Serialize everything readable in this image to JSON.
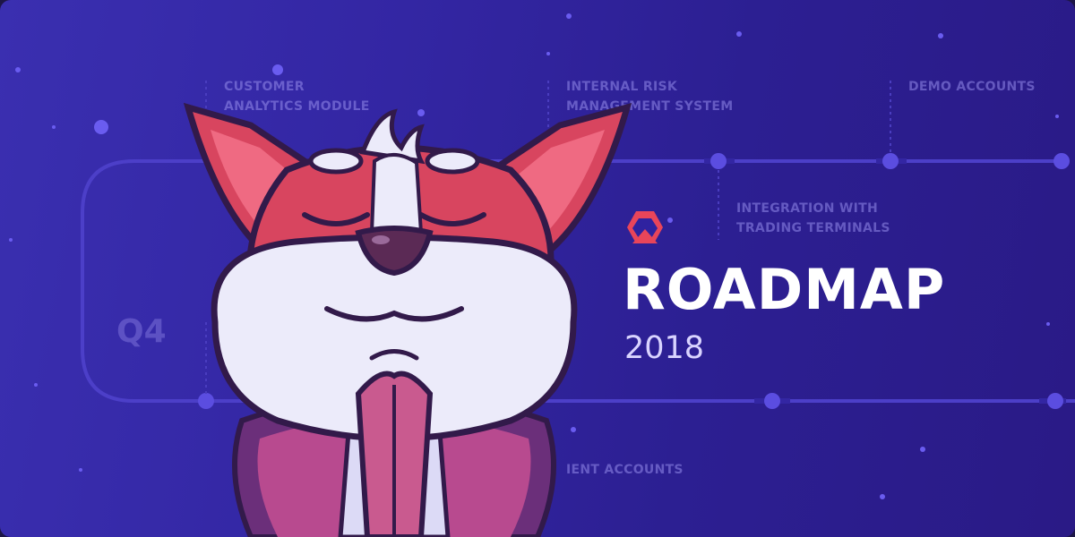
{
  "title": "ROADMAP",
  "year": "2018",
  "quarter_label": "Q4",
  "milestones": [
    {
      "label": "CUSTOMER\nANALYTICS MODULE"
    },
    {
      "label": "INTERNAL RISK\nMANAGEMENT SYSTEM"
    },
    {
      "label": "DEMO ACCOUNTS"
    },
    {
      "label": "INTEGRATION WITH\nTRADING TERMINALS"
    },
    {
      "label": "IENT ACCOUNTS"
    }
  ],
  "colors": {
    "background": "#3326a3",
    "timeline": "#5a4ad8",
    "logo": "#e8455a",
    "title": "#ffffff",
    "mascot_red": "#d8455f"
  },
  "icons": {
    "logo": "hexagon-logo-icon",
    "mascot": "fox-mascot"
  }
}
